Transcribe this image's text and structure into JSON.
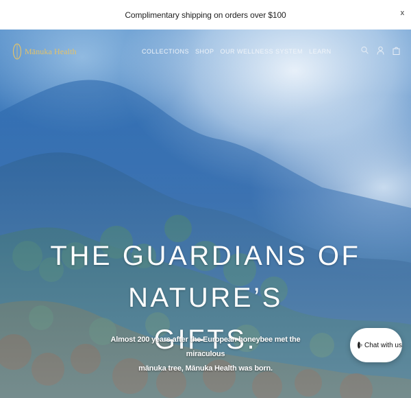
{
  "announcement": {
    "text": "Complimentary shipping on orders over $100",
    "close_label": "x"
  },
  "header": {
    "logo_text": "Mānuka Health",
    "nav": [
      {
        "label": "COLLECTIONS"
      },
      {
        "label": "SHOP"
      },
      {
        "label": "OUR WELLNESS SYSTEM"
      },
      {
        "label": "LEARN"
      }
    ],
    "icons": [
      "search-icon",
      "account-icon",
      "cart-icon"
    ]
  },
  "hero": {
    "headline_line1": "THE GUARDIANS OF NATURE’S",
    "headline_line2": "GIFTS.",
    "subtext_line1": "Almost 200 years after the European honeybee met the miraculous",
    "subtext_line2": "mānuka tree, Mānuka Health was born."
  },
  "chat": {
    "label": "Chat with us"
  },
  "colors": {
    "logo_gold": "#e2c26b",
    "sky_blue": "#2f6fb5",
    "text_white": "#ffffff"
  }
}
